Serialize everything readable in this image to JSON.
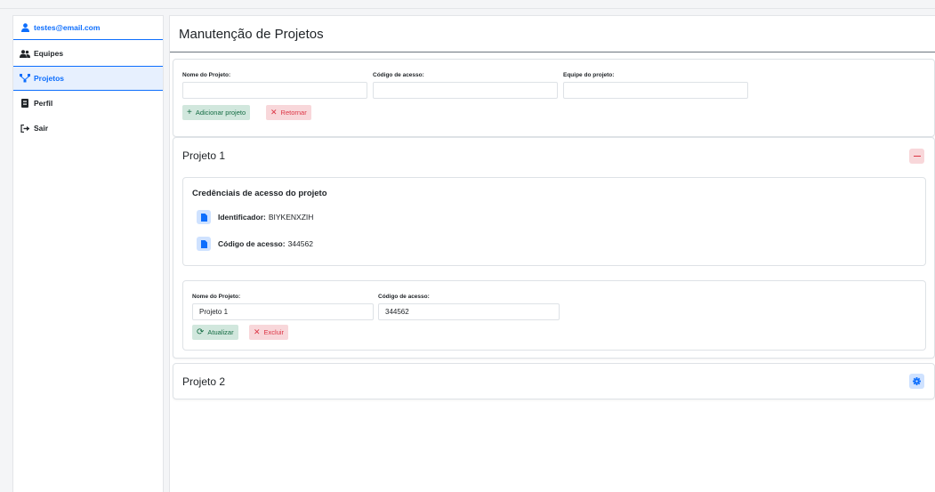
{
  "sidebar": {
    "user_email": "testes@email.com",
    "items": [
      {
        "label": "Equipes",
        "icon": "users-icon"
      },
      {
        "label": "Projetos",
        "icon": "sitemap-icon"
      },
      {
        "label": "Perfil",
        "icon": "id-card-icon"
      },
      {
        "label": "Sair",
        "icon": "sign-out-icon"
      }
    ]
  },
  "main": {
    "title": "Manutenção de Projetos",
    "filter": {
      "name_label": "Nome do Projeto:",
      "code_label": "Código de acesso:",
      "team_label": "Equipe do projeto:",
      "name_value": "",
      "code_value": "",
      "team_value": "",
      "add_label": "Adicionar projeto",
      "back_label": "Retornar"
    },
    "projects": [
      {
        "title": "Projeto 1",
        "credentials_title": "Credênciais de acesso do projeto",
        "identifier_label": "Identificador:",
        "identifier_value": "BIYKENXZIH",
        "code_label": "Código de acesso:",
        "code_value": "344562",
        "form": {
          "name_label": "Nome do Projeto:",
          "name_value": "Projeto 1",
          "code_label": "Código de acesso:",
          "code_value": "344562",
          "update_label": "Atualizar",
          "delete_label": "Excluir"
        }
      },
      {
        "title": "Projeto 2"
      }
    ]
  },
  "colors": {
    "accent": "#0d6efd",
    "success_bg": "#d1e7dd",
    "success_text": "#146c43",
    "danger_bg": "#f8d7da",
    "danger_text": "#dc3545"
  }
}
